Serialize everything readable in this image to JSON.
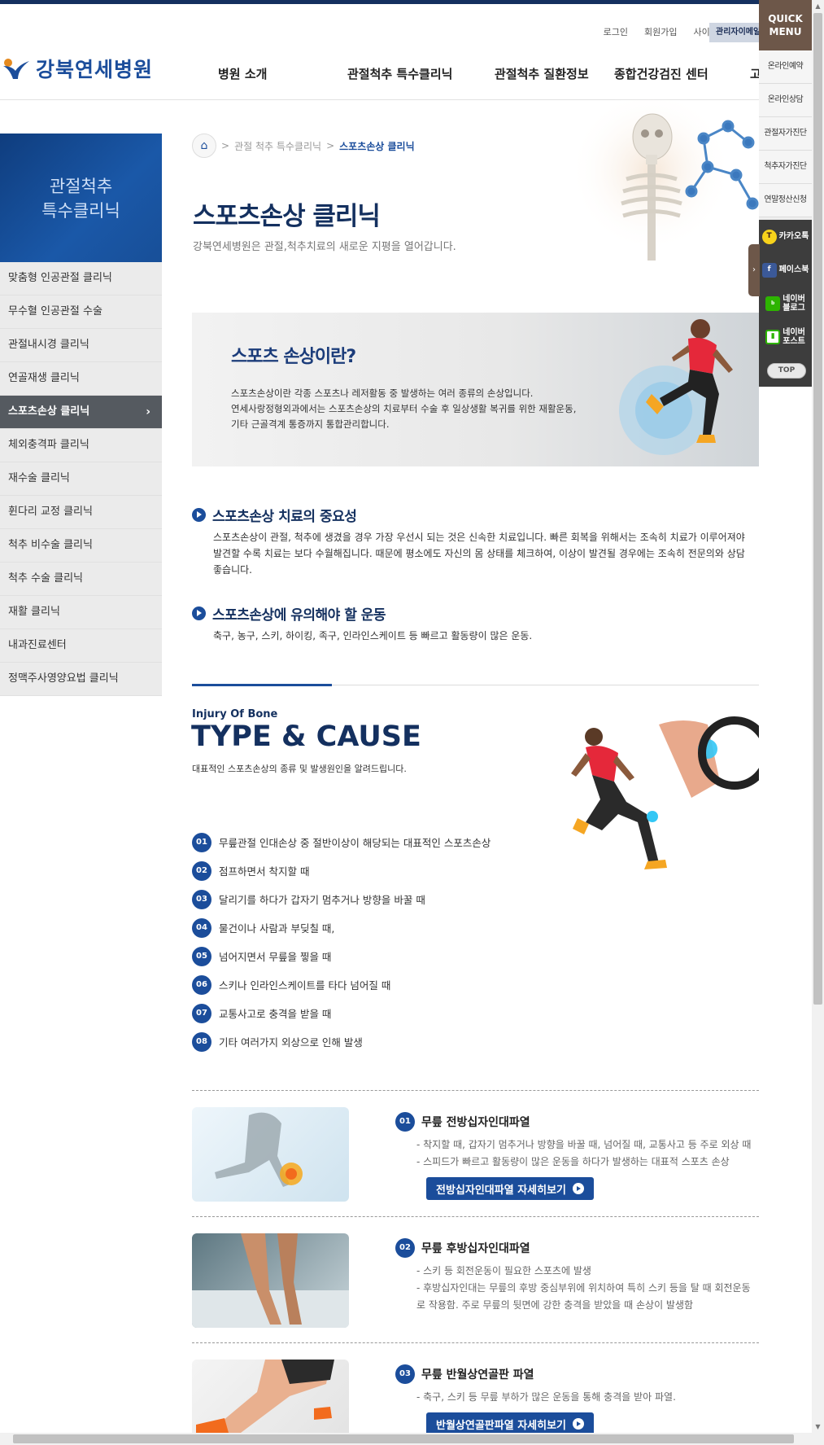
{
  "header": {
    "util_links": [
      "로그인",
      "회원가입",
      "사이트맵"
    ],
    "admin_label": "관리자이메일",
    "logo_text": "강북연세병원",
    "gnb": [
      "병원 소개",
      "관절척추 특수클리닉",
      "관절척추 질환정보",
      "종합건강검진 센터",
      "고"
    ]
  },
  "sidebar": {
    "title_line1": "관절척추",
    "title_line2": "특수클리닉",
    "items": [
      {
        "label": "맞춤형 인공관절 클리닉"
      },
      {
        "label": "무수혈 인공관절 수술"
      },
      {
        "label": "관절내시경 클리닉"
      },
      {
        "label": "연골재생 클리닉"
      },
      {
        "label": "스포츠손상 클리닉",
        "active": true
      },
      {
        "label": "체외충격파 클리닉"
      },
      {
        "label": "재수술 클리닉"
      },
      {
        "label": "휜다리 교정 클리닉"
      },
      {
        "label": "척추 비수술 클리닉"
      },
      {
        "label": "척추 수술 클리닉"
      },
      {
        "label": "재활 클리닉"
      },
      {
        "label": "내과진료센터"
      },
      {
        "label": "정맥주사영양요법 클리닉"
      }
    ],
    "active_arrow": "›"
  },
  "breadcrumb": {
    "parent": "관절 척추 특수클리닉",
    "current": "스포츠손상 클리닉",
    "sep": ">"
  },
  "page": {
    "title": "스포츠손상 클리닉",
    "subtitle": "강북연세병원은 관절,척추치료의 새로운 지평을 열어갑니다."
  },
  "banner": {
    "title": "스포츠 손상이란?",
    "lines": [
      "스포츠손상이란 각종 스포츠나 레저활동 중 발생하는 여러 종류의 손상입니다.",
      "연세사랑정형외과에서는 스포츠손상의 치료부터 수술 후 일상생활 복귀를 위한 재활운동,",
      "기타 근골격계 통증까지 통합관리합니다."
    ]
  },
  "importance": {
    "title": "스포츠손상 치료의 중요성",
    "lines": [
      "스포츠손상이 관절, 척추에 생겼을 경우 가장 우선시 되는 것은 신속한 치료입니다. 빠른 회복을 위해서는 조속히 치료가 이루어져야",
      "발견할 수록 치료는 보다 수월해집니다. 때문에 평소에도 자신의 몸 상태를 체크하여, 이상이 발견될 경우에는 조속히 전문의와 상담",
      "좋습니다."
    ]
  },
  "caution": {
    "title": "스포츠손상에 유의해야 할 운동",
    "text": "축구, 농구, 스키, 하이킹, 족구, 인라인스케이트 등 빠르고 활동량이 많은 운동."
  },
  "type_cause": {
    "small": "Injury Of Bone",
    "big": "TYPE & CAUSE",
    "desc": "대표적인 스포츠손상의 종류 및 발생원인을 알려드립니다.",
    "items": [
      {
        "num": "01",
        "text": "무릎관절 인대손상 중 절반이상이 해당되는 대표적인 스포츠손상"
      },
      {
        "num": "02",
        "text": "점프하면서 착지할 때"
      },
      {
        "num": "03",
        "text": "달리기를 하다가 갑자기 멈추거나 방향을 바꿀 때"
      },
      {
        "num": "04",
        "text": "물건이나 사람과 부딪칠 때,"
      },
      {
        "num": "05",
        "text": "넘어지면서 무릎을 찧을 때"
      },
      {
        "num": "06",
        "text": "스키나 인라인스케이트를 타다 넘어질 때"
      },
      {
        "num": "07",
        "text": "교통사고로 충격을 받을 때"
      },
      {
        "num": "08",
        "text": "기타 여러가지 외상으로 인해 발생"
      }
    ]
  },
  "injuries": [
    {
      "num": "01",
      "title": "무릎 전방십자인대파열",
      "lines": [
        "- 착지할 때, 갑자기 멈추거나 방향을 바꿀 때, 넘어질 때, 교통사고 등 주로 외상 때",
        "- 스피드가 빠르고 활동량이 많은 운동을 하다가 발생하는 대표적 스포츠 손상"
      ],
      "button": "전방십자인대파열 자세히보기"
    },
    {
      "num": "02",
      "title": "무릎 후방십자인대파열",
      "lines": [
        "- 스키 등 회전운동이 필요한 스포츠에 발생",
        "- 후방십자인대는 무릎의 후방 중심부위에 위치하여 특히 스키 등을 탈 때 회전운동",
        "로 작용함. 주로 무릎의 뒷면에 강한 충격을 받았을 때 손상이 발생함"
      ],
      "button": ""
    },
    {
      "num": "03",
      "title": "무릎 반월상연골판 파열",
      "lines": [
        "- 축구, 스키 등 무릎 부하가 많은 운동을 통해 충격을 받아 파열."
      ],
      "button": "반월상연골판파열 자세히보기"
    }
  ],
  "quick_menu": {
    "head_line1": "QUICK",
    "head_line2": "MENU",
    "items": [
      "온라인예약",
      "온라인상담",
      "관절자가진단",
      "척추자가진단",
      "연말정산신청"
    ],
    "sns": [
      {
        "label": "카카오톡",
        "icon": "kakao-icon"
      },
      {
        "label": "페이스북",
        "icon": "facebook-icon"
      },
      {
        "label_line1": "네이버",
        "label_line2": "블로그",
        "icon": "blog-icon"
      },
      {
        "label_line1": "네이버",
        "label_line2": "포스트",
        "icon": "post-icon"
      }
    ],
    "top": "TOP",
    "toggle": "›"
  },
  "colors": {
    "navy": "#14305f",
    "blue": "#1b4d9b",
    "quick_brown": "#6d5749"
  }
}
